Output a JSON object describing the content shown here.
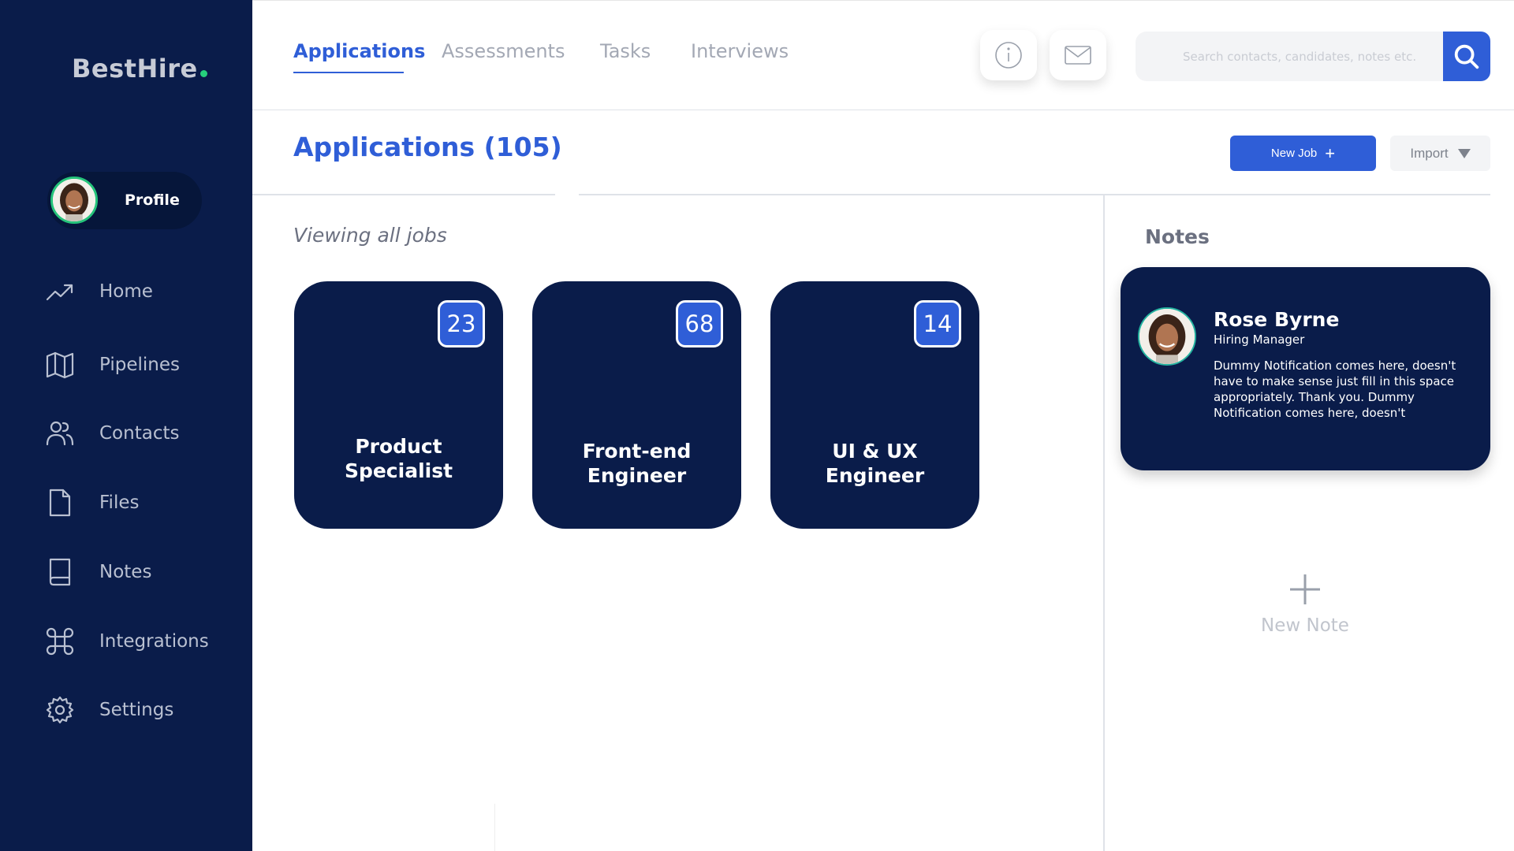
{
  "brand": "BestHire",
  "sidebar": {
    "profile_label": "Profile",
    "items": [
      {
        "label": "Home",
        "icon": "trending-up-icon"
      },
      {
        "label": "Pipelines",
        "icon": "map-icon"
      },
      {
        "label": "Contacts",
        "icon": "users-icon"
      },
      {
        "label": "Files",
        "icon": "file-icon"
      },
      {
        "label": "Notes",
        "icon": "book-icon"
      },
      {
        "label": "Integrations",
        "icon": "command-icon"
      },
      {
        "label": "Settings",
        "icon": "gear-icon"
      }
    ]
  },
  "header": {
    "tabs": [
      {
        "label": "Applications",
        "active": true
      },
      {
        "label": "Assessments",
        "active": false
      },
      {
        "label": "Tasks",
        "active": false
      },
      {
        "label": "Interviews",
        "active": false
      }
    ],
    "search_placeholder": "Search contacts, candidates, notes etc."
  },
  "main": {
    "title": "Applications (105)",
    "new_job_label": "New Job",
    "import_label": "Import",
    "viewing_label": "Viewing all jobs",
    "jobs": [
      {
        "title": "Product\nSpecialist",
        "count": "23"
      },
      {
        "title": "Front-end\nEngineer",
        "count": "68"
      },
      {
        "title": "UI & UX\nEngineer",
        "count": "14"
      }
    ]
  },
  "notes": {
    "heading": "Notes",
    "items": [
      {
        "name": "Rose Byrne",
        "role": "Hiring Manager",
        "body": "Dummy Notification comes here, doesn't have to make sense just fill in this space appropriately. Thank you. Dummy Notification comes here, doesn't"
      }
    ],
    "new_note_label": "New Note"
  },
  "colors": {
    "sidebar": "#0a1c4a",
    "accent": "#2f5ed7",
    "brand_dot": "#26d07c"
  }
}
